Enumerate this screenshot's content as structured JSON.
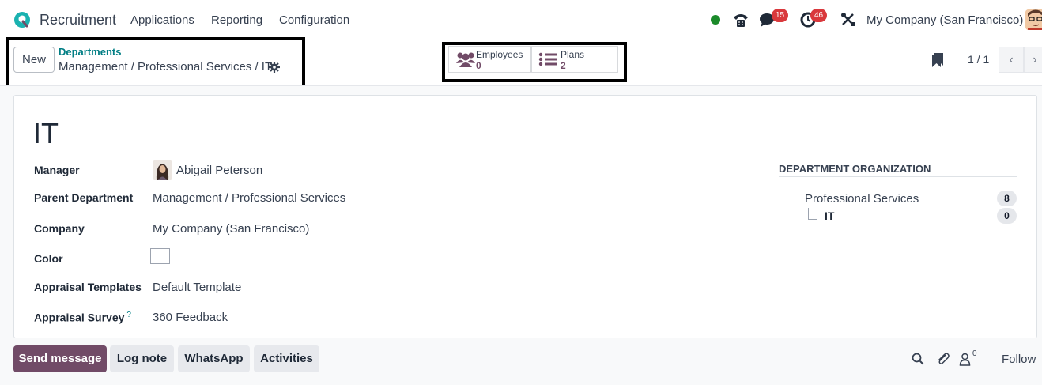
{
  "navbar": {
    "app_name": "Recruitment",
    "menu": [
      "Applications",
      "Reporting",
      "Configuration"
    ],
    "messages_count": "15",
    "activities_count": "46",
    "company": "My Company (San Francisco)",
    "status_color": "#1b8a2a"
  },
  "control_panel": {
    "new_label": "New",
    "breadcrumb_parent": "Departments",
    "breadcrumb_current": "Management / Professional Services / IT",
    "smart_buttons": [
      {
        "label": "Employees",
        "value": "0",
        "icon": "users-icon"
      },
      {
        "label": "Plans",
        "value": "2",
        "icon": "list-icon"
      }
    ],
    "pager": "1 / 1"
  },
  "form": {
    "title": "IT",
    "fields": {
      "manager_label": "Manager",
      "manager_value": "Abigail Peterson",
      "parent_label": "Parent Department",
      "parent_value": "Management / Professional Services",
      "company_label": "Company",
      "company_value": "My Company (San Francisco)",
      "color_label": "Color",
      "appraisal_templates_label": "Appraisal Templates",
      "appraisal_templates_value": "Default Template",
      "appraisal_survey_label": "Appraisal Survey",
      "appraisal_survey_help": "?",
      "appraisal_survey_value": "360 Feedback"
    },
    "organization": {
      "title": "DEPARTMENT ORGANIZATION",
      "parent_name": "Professional Services",
      "parent_count": "8",
      "child_name": "IT",
      "child_count": "0"
    }
  },
  "chatter": {
    "send_message": "Send message",
    "log_note": "Log note",
    "whatsapp": "WhatsApp",
    "activities": "Activities",
    "followers_count": "0",
    "follow": "Follow"
  },
  "colors": {
    "brand": "#714b67",
    "link": "#017e84",
    "badge": "#d9383c"
  }
}
